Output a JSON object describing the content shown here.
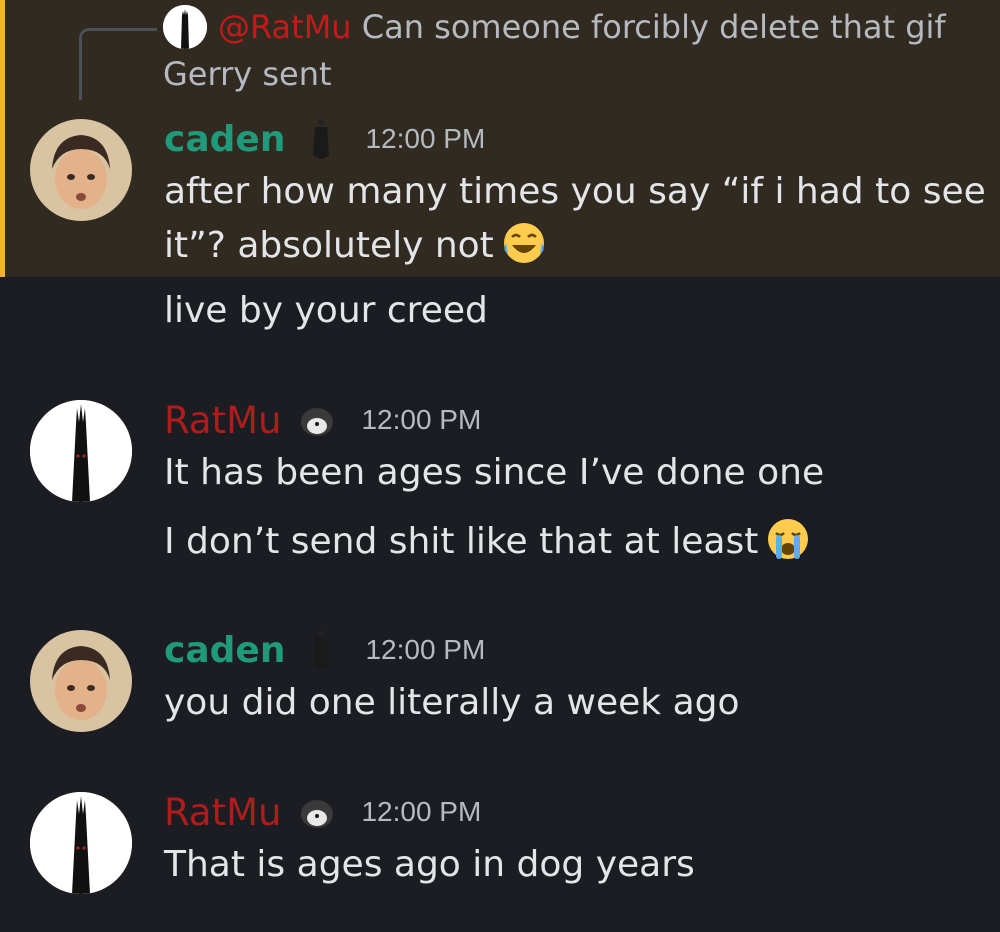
{
  "reply": {
    "mention": "@RatMu",
    "text": "Can someone forcibly delete that gif",
    "text_cont": "Gerry sent"
  },
  "messages": [
    {
      "author": "caden",
      "timestamp": "12:00 PM",
      "lines": [
        "after how many times you say “if i had to see",
        "it”? absolutely not"
      ],
      "followup": "live by your creed",
      "emoji": "joy-emoji"
    },
    {
      "author": "RatMu",
      "timestamp": "12:00 PM",
      "lines": [
        "It has been ages since I’ve done one",
        "I don’t send shit like that at least"
      ],
      "emoji": "sob-emoji"
    },
    {
      "author": "caden",
      "timestamp": "12:00 PM",
      "lines": [
        "you did one literally a week ago"
      ]
    },
    {
      "author": "RatMu",
      "timestamp": "12:00 PM",
      "lines": [
        "That is ages ago in dog years"
      ]
    }
  ],
  "colors": {
    "background": "#1c1d22",
    "highlight": "#302a21",
    "highlight_bar": "#f0b232",
    "caden": "#1f9a7a",
    "ratmu": "#b01c1c",
    "mention": "#c51a1a"
  }
}
